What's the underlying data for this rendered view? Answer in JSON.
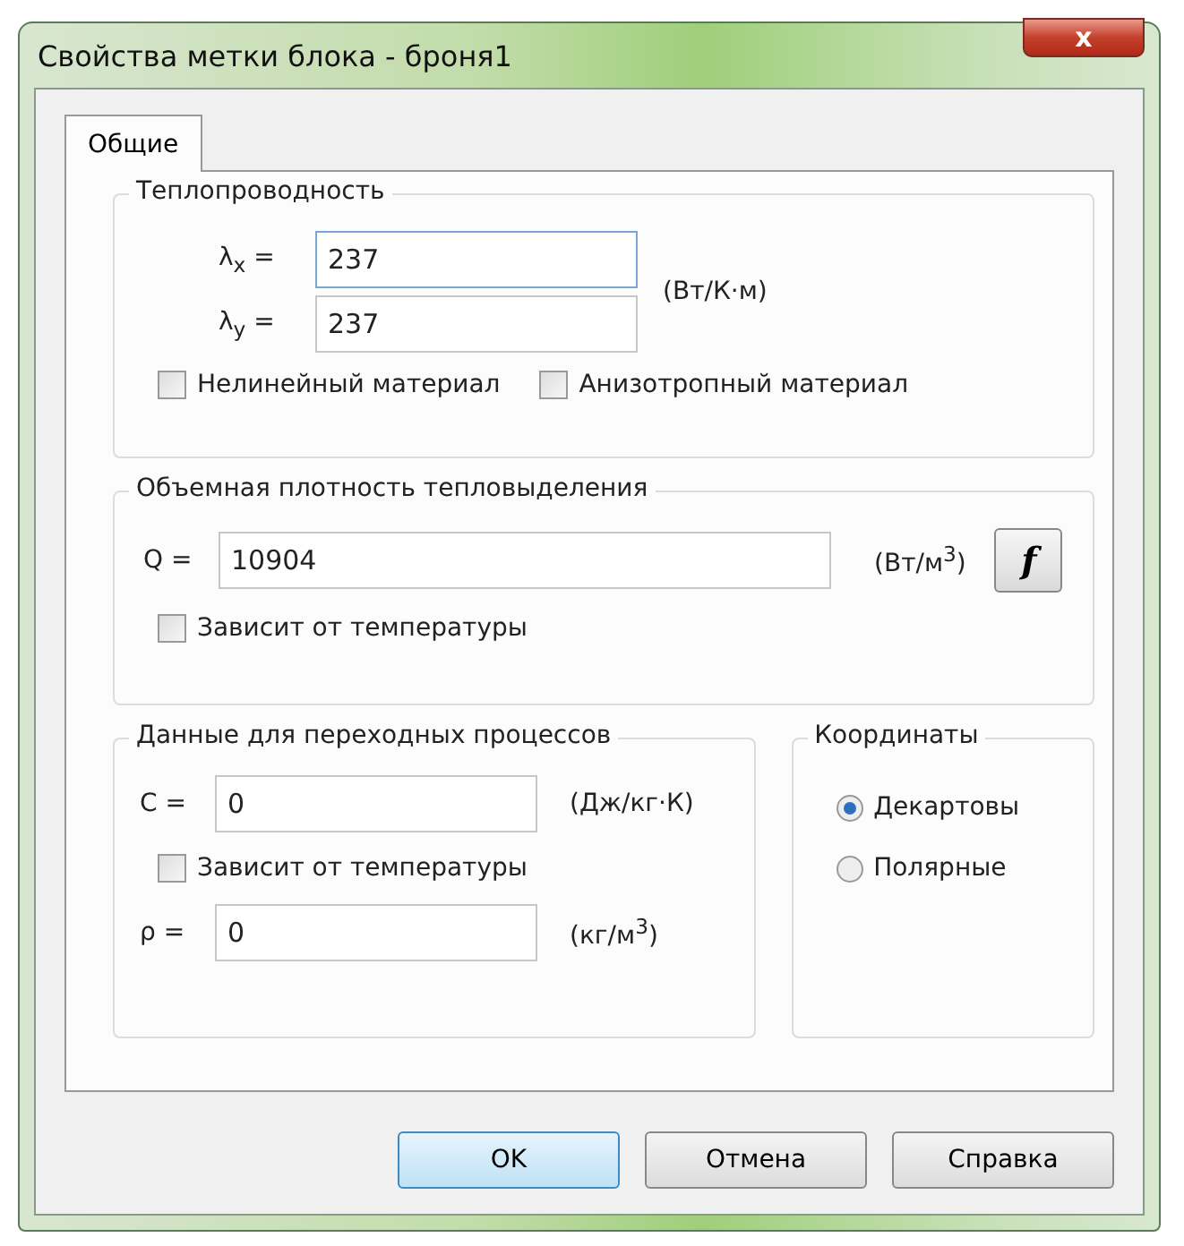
{
  "window": {
    "title": "Свойства метки блока - броня1",
    "close": "x"
  },
  "tabs": [
    {
      "label": "Общие",
      "selected": true
    }
  ],
  "conductivity": {
    "title": "Теплопроводность",
    "fields": [
      {
        "label": "λ$_{x}$ =",
        "value": "237"
      },
      {
        "label": "λ$_{y}$ =",
        "value": "237"
      }
    ],
    "unit": "(Вт/К·м)",
    "checks": [
      {
        "label": "Нелинейный материал",
        "checked": false
      },
      {
        "label": "Анизотропный материал",
        "checked": false
      }
    ]
  },
  "heat": {
    "title": "Объемная плотность тепловыделения",
    "label": "Q =",
    "value": "10904",
    "unit": "(Вт/м$^{3}$)",
    "func_button": "f",
    "check": {
      "label": "Зависит от температуры",
      "checked": false
    }
  },
  "transient": {
    "title": "Данные для переходных процессов",
    "c": {
      "label": "C =",
      "value": "0",
      "unit": "(Дж/кг·К)"
    },
    "check": {
      "label": "Зависит от температуры",
      "checked": false
    },
    "rho": {
      "label": "ρ =",
      "value": "0",
      "unit": "(кг/м$^{3}$)"
    }
  },
  "coords": {
    "title": "Координаты",
    "options": [
      {
        "label": "Декартовы",
        "selected": true
      },
      {
        "label": "Полярные",
        "selected": false
      }
    ]
  },
  "buttons": [
    {
      "label": "OK",
      "default": true
    },
    {
      "label": "Отмена",
      "default": false
    },
    {
      "label": "Справка",
      "default": false
    }
  ]
}
